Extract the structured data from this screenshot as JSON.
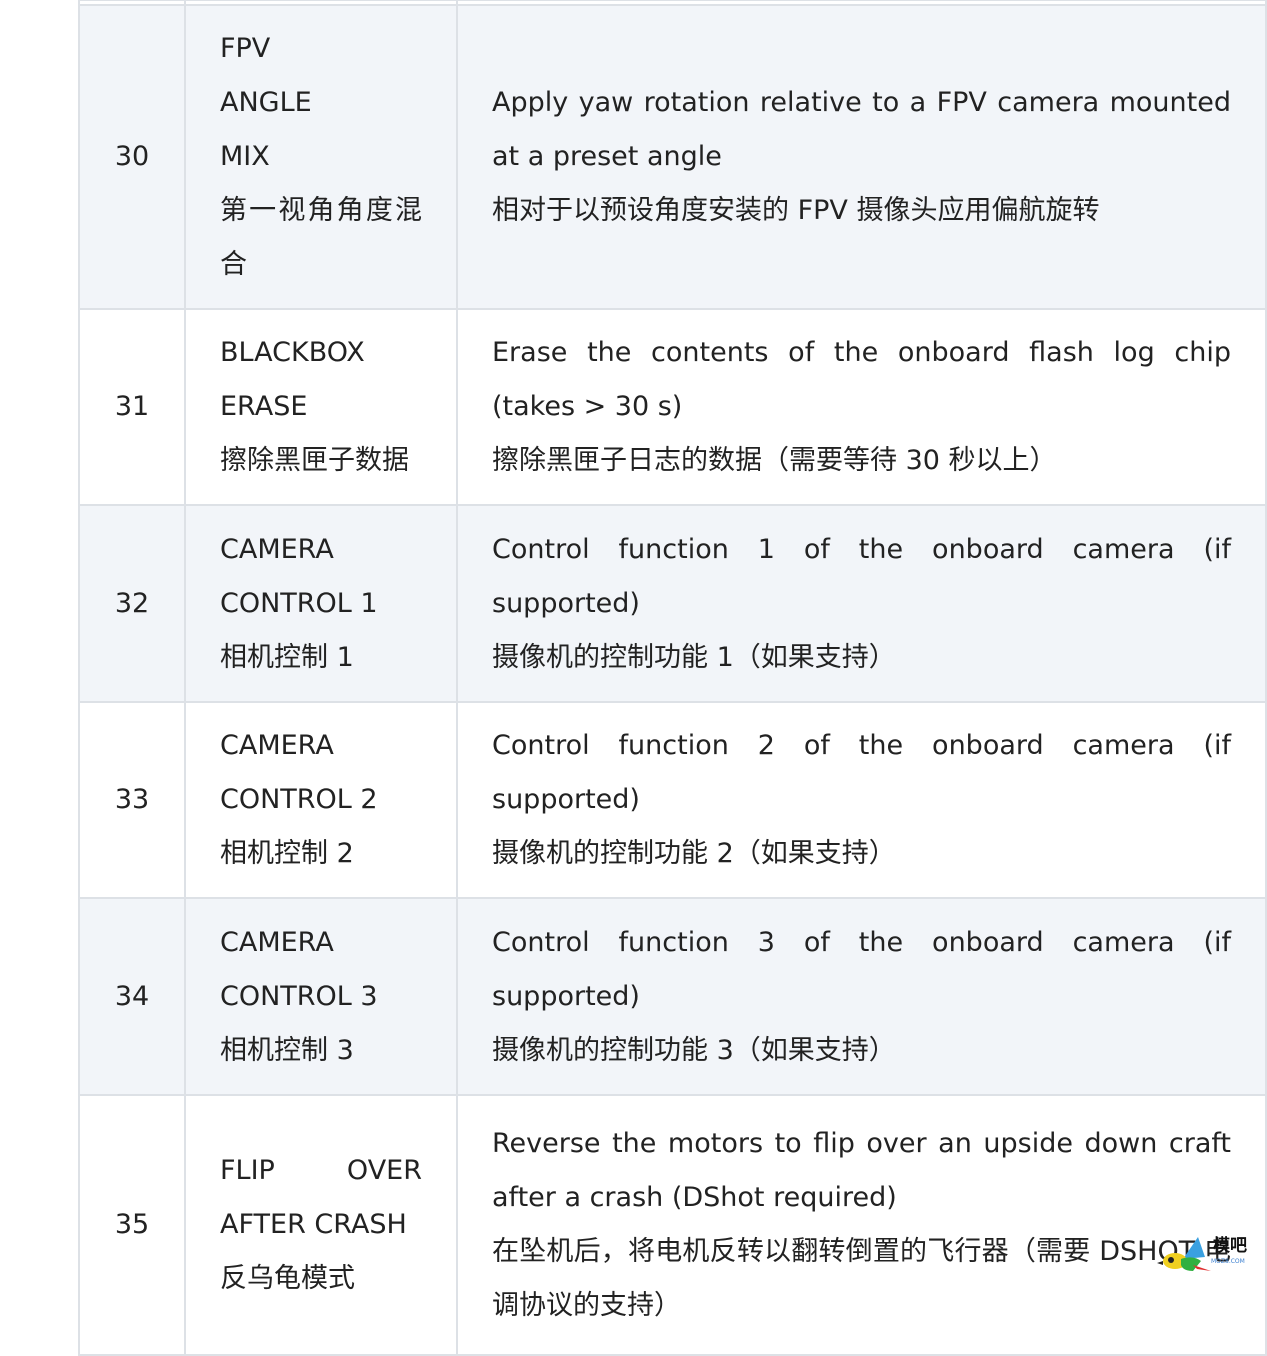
{
  "rows": [
    {
      "num": "30",
      "name_en": "FPV ANGLE MIX",
      "name_zh": "第一视角角度混合",
      "desc_en": "Apply yaw rotation relative to a FPV camera mounted at a preset angle",
      "desc_zh": "相对于以预设角度安装的 FPV 摄像头应用偏航旋转"
    },
    {
      "num": "31",
      "name_en": "BLACKBOX ERASE",
      "name_zh": "擦除黑匣子数据",
      "desc_en": "Erase the contents of the onboard flash log chip (takes > 30 s)",
      "desc_zh": "擦除黑匣子日志的数据（需要等待 30 秒以上）"
    },
    {
      "num": "32",
      "name_en": "CAMERA CONTROL 1",
      "name_zh": "相机控制 1",
      "desc_en": "Control function 1 of the onboard camera (if supported)",
      "desc_zh": "摄像机的控制功能 1（如果支持）"
    },
    {
      "num": "33",
      "name_en": "CAMERA CONTROL 2",
      "name_zh": "相机控制 2",
      "desc_en": "Control function 2 of the onboard camera (if supported)",
      "desc_zh": "摄像机的控制功能 2（如果支持）"
    },
    {
      "num": "34",
      "name_en": "CAMERA CONTROL 3",
      "name_zh": "相机控制 3",
      "desc_en": "Control function 3 of the onboard camera (if supported)",
      "desc_zh": "摄像机的控制功能 3（如果支持）"
    },
    {
      "num": "35",
      "name_en": "FLIP OVER AFTER CRASH",
      "name_zh": "反乌龟模式",
      "desc_en": "Reverse the motors to flip over an upside down craft after a crash (DShot required)",
      "desc_zh": "在坠机后，将电机反转以翻转倒置的飞行器（需要 DSHOT 电调协议的支持）"
    }
  ],
  "watermark": {
    "text": "模吧",
    "sub": "MOZ8.COM"
  }
}
